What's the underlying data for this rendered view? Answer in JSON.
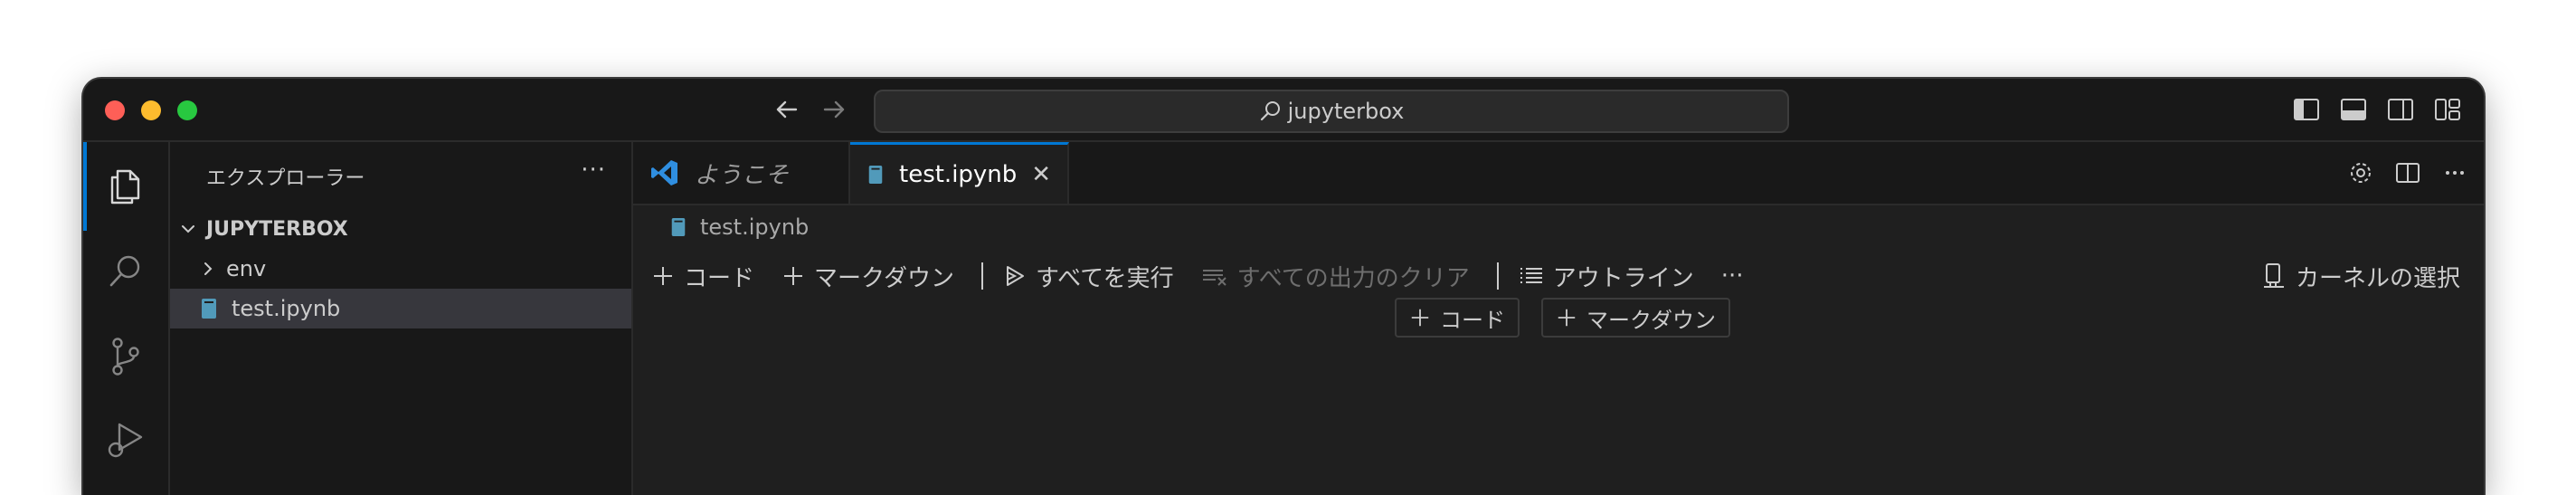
{
  "titlebar": {
    "search_text": "jupyterbox"
  },
  "sidebar": {
    "title": "エクスプローラー",
    "more": "···",
    "folder": "JUPYTERBOX",
    "items": [
      {
        "label": "env",
        "type": "folder"
      },
      {
        "label": "test.ipynb",
        "type": "notebook",
        "selected": true
      }
    ]
  },
  "tabs": [
    {
      "label": "ようこそ",
      "active": false
    },
    {
      "label": "test.ipynb",
      "active": true
    }
  ],
  "breadcrumb": "test.ipynb",
  "toolbar": {
    "code": "コード",
    "markdown": "マークダウン",
    "run_all": "すべてを実行",
    "clear_outputs": "すべての出力のクリア",
    "outline": "アウトライン",
    "more": "···",
    "kernel": "カーネルの選択"
  },
  "cell_add": {
    "code": "コード",
    "markdown": "マークダウン"
  },
  "colors": {
    "accent": "#0078d4",
    "bg_editor": "#1f1f1f",
    "bg_side": "#181818",
    "selected_row": "#37373d"
  }
}
